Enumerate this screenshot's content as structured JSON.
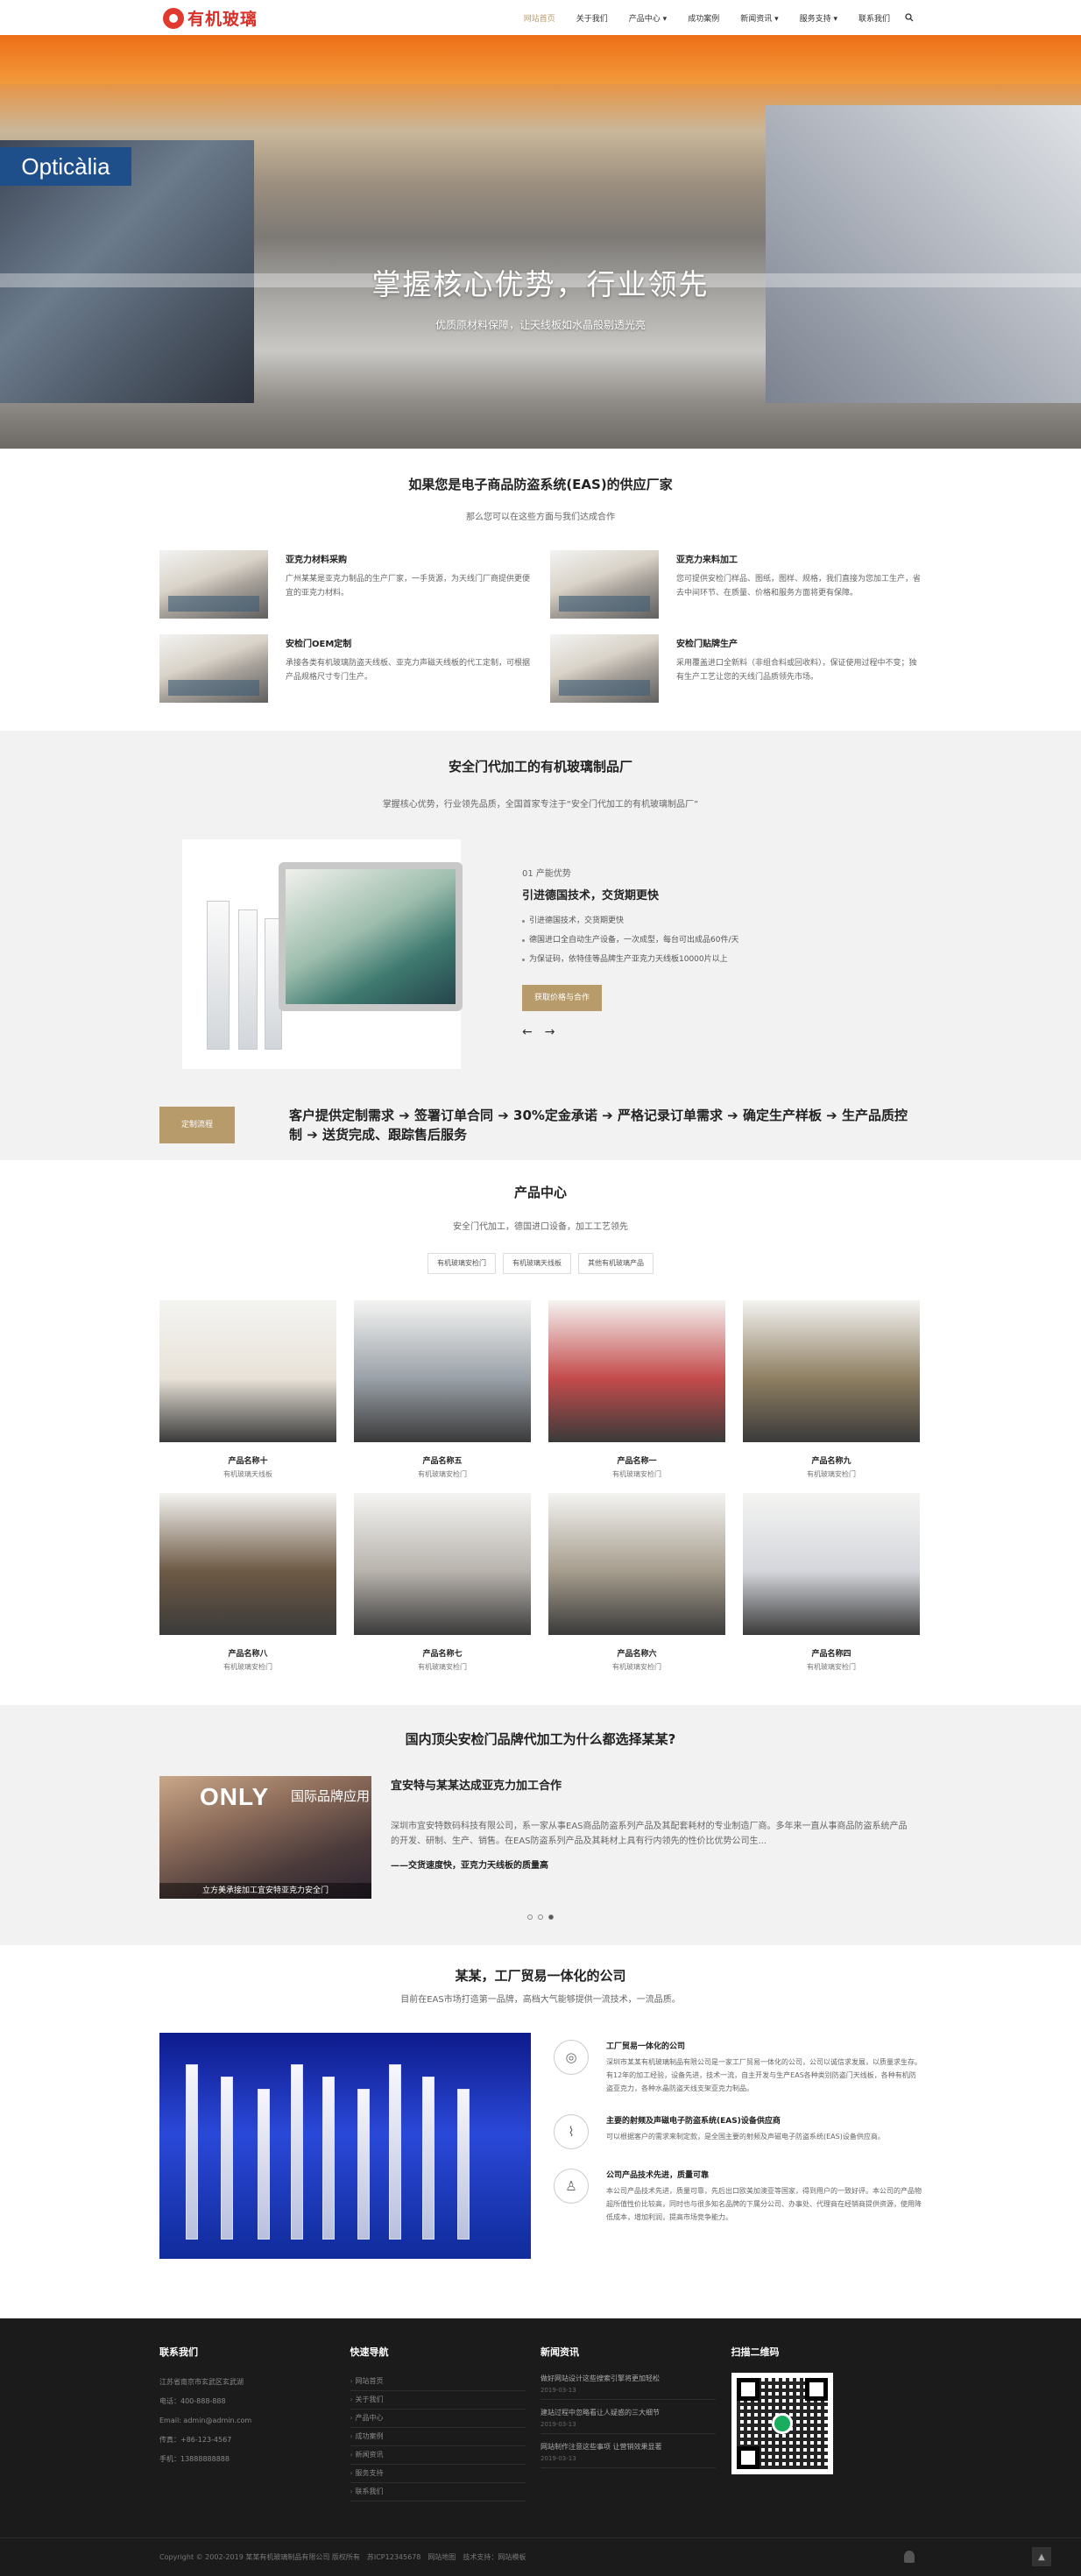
{
  "header": {
    "logo_text": "有机玻璃",
    "nav": [
      {
        "label": "网站首页",
        "active": true
      },
      {
        "label": "关于我们"
      },
      {
        "label": "产品中心 ▾"
      },
      {
        "label": "成功案例"
      },
      {
        "label": "新闻资讯 ▾"
      },
      {
        "label": "服务支持 ▾"
      },
      {
        "label": "联系我们"
      }
    ]
  },
  "hero": {
    "store_sign": "Opticàlia",
    "title": "掌握核心优势，行业领先",
    "subtitle": "优质原材料保障，让天线板如水晶般剔透光亮"
  },
  "supplier": {
    "title": "如果您是电子商品防盗系统(EAS)的供应厂家",
    "subtitle": "那么您可以在这些方面与我们达成合作",
    "items": [
      {
        "title": "亚克力材料采购",
        "text": "广州某某是亚克力制品的生产厂家，一手货源，为天线门厂商提供更便宜的亚克力材料。"
      },
      {
        "title": "亚克力来料加工",
        "text": "您可提供安检门样品、图纸，图样、规格，我们直接为您加工生产，省去中间环节、在质量、价格和服务方面将更有保障。"
      },
      {
        "title": "安检门OEM定制",
        "text": "承接各类有机玻璃防盗天线板、亚克力声磁天线板的代工定制，可根据产品规格尺寸专门生产。"
      },
      {
        "title": "安检门贴牌生产",
        "text": "采用覆盖进口全新料（非组合料或回收料），保证使用过程中不变；独有生产工艺让您的天线门品质领先市场。"
      }
    ]
  },
  "oem": {
    "title": "安全门代加工的有机玻璃制品厂",
    "subtitle": "掌握核心优势，行业领先品质，全国首家专注于“安全门代加工的有机玻璃制品厂”",
    "tag": "01 产能优势",
    "heading": "引进德国技术，交货期更快",
    "bullets": [
      "引进德国技术，交货期更快",
      "德国进口全自动生产设备，一次成型，每台可出成品60件/天",
      "为保证码，依特佳等品牌生产亚克力天线板10000片以上"
    ],
    "button": "获取价格与合作",
    "arrow_prev": "←",
    "arrow_next": "→",
    "flow_button": "定制流程",
    "flow_text": "客户提供定制需求 ➔ 签署订单合同 ➔ 30%定金承诺 ➔ 严格记录订单需求 ➔ 确定生产样板 ➔ 生产品质控制 ➔ 送货完成、跟踪售后服务"
  },
  "products": {
    "title": "产品中心",
    "subtitle": "安全门代加工，德国进口设备，加工工艺领先",
    "tabs": [
      "有机玻璃安检门",
      "有机玻璃天线板",
      "其他有机玻璃产品"
    ],
    "items": [
      {
        "name": "产品名称十",
        "category": "有机玻璃天线板",
        "color": "#e8e2d8"
      },
      {
        "name": "产品名称五",
        "category": "有机玻璃安检门",
        "color": "#9aa1a8"
      },
      {
        "name": "产品名称一",
        "category": "有机玻璃安检门",
        "color": "#c44b4b"
      },
      {
        "name": "产品名称九",
        "category": "有机玻璃安检门",
        "color": "#8f7f62"
      },
      {
        "name": "产品名称八",
        "category": "有机玻璃安检门",
        "color": "#6e5a45"
      },
      {
        "name": "产品名称七",
        "category": "有机玻璃安检门",
        "color": "#b8b3ad"
      },
      {
        "name": "产品名称六",
        "category": "有机玻璃安检门",
        "color": "#a69d8d"
      },
      {
        "name": "产品名称四",
        "category": "有机玻璃安检门",
        "color": "#d4d6db"
      }
    ]
  },
  "why": {
    "title": "国内顶尖安检门品牌代加工为什么都选择某某?",
    "logo": "ONLY",
    "logo_sub": "国际品牌应用",
    "caption": "立方美承接加工宜安特亚克力安全门",
    "heading": "宜安特与某某达成亚克力加工合作",
    "text": "深圳市宜安特数码科技有限公司，系一家从事EAS商品防盗系列产品及其配套耗材的专业制造厂商。多年来一直从事商品防盗系统产品的开发、研制、生产、销售。在EAS防盗系列产品及其耗材上具有行内领先的性价比优势公司生...",
    "note": "——交货速度快，亚克力天线板的质量高"
  },
  "company": {
    "title": "某某，工厂贸易一体化的公司",
    "subtitle": "目前在EAS市场打造第一品牌，高档大气能够提供一流技术，一流品质。",
    "features": [
      {
        "icon": "◎",
        "title": "工厂贸易一体化的公司",
        "text": "深圳市某某有机玻璃制品有限公司是一家工厂贸易一体化的公司，公司以诚信求发展，以质量求生存。有12年的加工经验，设备先进，技术一流，自主开发与生产EAS各种类别防盗门天线板，各种有机防盗亚克力，各种水晶防盗天线支架亚克力制品。"
      },
      {
        "icon": "⌇",
        "title": "主要的射频及声磁电子防盗系统(EAS)设备供应商",
        "text": "可以根据客户的需求来制定款，是全国主要的射频及声磁电子防盗系统(EAS)设备供应商。"
      },
      {
        "icon": "♙",
        "title": "公司产品技术先进，质量可靠",
        "text": "本公司产品技术先进，质量可靠，先后出口欧美加澳亚等国家，得到用户的一致好评。本公司的产品物超所值性价比较高，同时也与很多知名品牌的下属分公司、办事处、代理商在经销商提供资源，使用降低成本，增加利润，提高市场竞争能力。"
      }
    ]
  },
  "footer": {
    "contact_title": "联系我们",
    "contact": [
      "江苏省南京市玄武区玄武湖",
      "电话：400-888-888",
      "Email: admin@admin.com",
      "传真：+86-123-4567",
      "手机：13888888888"
    ],
    "nav_title": "快速导航",
    "nav": [
      "网站首页",
      "关于我们",
      "产品中心",
      "成功案例",
      "新闻资讯",
      "服务支持",
      "联系我们"
    ],
    "news_title": "新闻资讯",
    "news": [
      {
        "title": "做好网站设计这些搜索引擎将更加轻松",
        "date": "2019-03-13"
      },
      {
        "title": "建站过程中忽略看让人疑惑的三大细节",
        "date": "2019-03-13"
      },
      {
        "title": "网站制作注意这些事项 让营销效果显著",
        "date": "2019-03-13"
      }
    ],
    "qr_title": "扫描二维码",
    "copyright": "Copyright © 2002-2019 某某有机玻璃制品有限公司 版权所有　苏ICP12345678　网站地图　技术支持：网站模板",
    "to_top": "▲"
  }
}
